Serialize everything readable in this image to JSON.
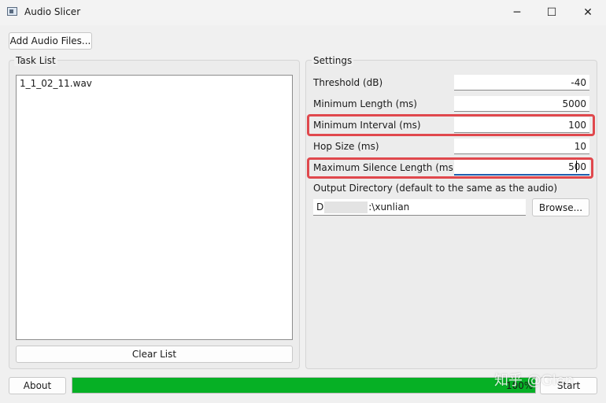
{
  "window": {
    "title": "Audio Slicer",
    "minimize_glyph": "─",
    "maximize_glyph": "☐",
    "close_glyph": "✕"
  },
  "toolbar": {
    "add_files_label": "Add Audio Files..."
  },
  "task_list": {
    "title": "Task List",
    "items": [
      "1_1_02_11.wav"
    ],
    "clear_label": "Clear List"
  },
  "settings": {
    "title": "Settings",
    "threshold": {
      "label": "Threshold (dB)",
      "value": "-40"
    },
    "min_length": {
      "label": "Minimum Length (ms)",
      "value": "5000"
    },
    "min_interval": {
      "label": "Minimum Interval (ms)",
      "value": "100"
    },
    "hop_size": {
      "label": "Hop Size (ms)",
      "value": "10"
    },
    "max_silence": {
      "label": "Maximum Silence Length (ms)",
      "value": "500"
    },
    "output_dir": {
      "label": "Output Directory (default to the same as the audio)",
      "prefix": "D",
      "suffix": ":\\xunlian",
      "browse_label": "Browse..."
    }
  },
  "footer": {
    "about_label": "About",
    "progress_text": "100%",
    "progress_fraction": 1.0,
    "start_label": "Start"
  },
  "watermark": "知乎 @Glen",
  "colors": {
    "progress": "#06b025",
    "highlight": "#e0484d",
    "focus": "#1f5fb0"
  }
}
